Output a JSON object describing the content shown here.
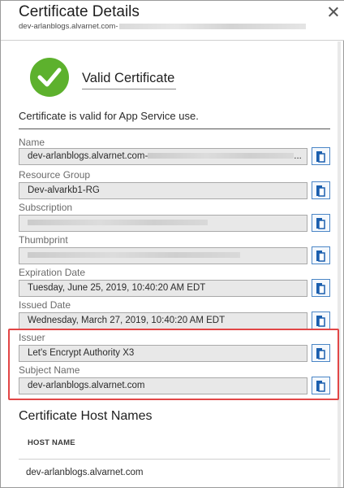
{
  "header": {
    "title": "Certificate Details",
    "subtitle": "dev-arlanblogs.alvarnet.com-"
  },
  "status": {
    "heading": "Valid Certificate",
    "message": "Certificate is valid for App Service use.",
    "icon": "check-icon",
    "color": "#5db12d"
  },
  "fields": {
    "name": {
      "label": "Name",
      "value": "dev-arlanblogs.alvarnet.com-",
      "suffix": "..."
    },
    "resource_group": {
      "label": "Resource Group",
      "value": "Dev-alvarkb1-RG"
    },
    "subscription": {
      "label": "Subscription",
      "value": ""
    },
    "thumbprint": {
      "label": "Thumbprint",
      "value": ""
    },
    "expiration_date": {
      "label": "Expiration Date",
      "value": "Tuesday, June 25, 2019, 10:40:20 AM EDT"
    },
    "issued_date": {
      "label": "Issued Date",
      "value": "Wednesday, March 27, 2019, 10:40:20 AM EDT"
    },
    "issuer": {
      "label": "Issuer",
      "value": "Let's Encrypt Authority X3"
    },
    "subject_name": {
      "label": "Subject Name",
      "value": "dev-arlanblogs.alvarnet.com"
    }
  },
  "host_names": {
    "title": "Certificate Host Names",
    "column": "HOST NAME",
    "rows": [
      "dev-arlanblogs.alvarnet.com"
    ]
  },
  "colors": {
    "accent": "#4b86c6",
    "highlight": "#e24646"
  }
}
